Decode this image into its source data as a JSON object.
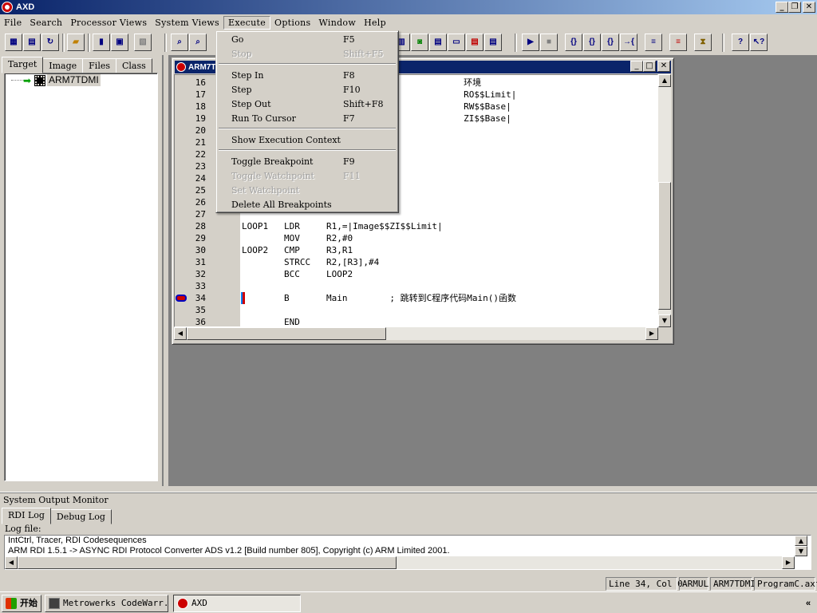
{
  "app": {
    "title": "AXD"
  },
  "menubar": [
    "File",
    "Search",
    "Processor Views",
    "System Views",
    "Execute",
    "Options",
    "Window",
    "Help"
  ],
  "execute_menu": {
    "items": [
      {
        "label": "Go",
        "key": "F5",
        "enabled": true
      },
      {
        "label": "Stop",
        "key": "Shift+F5",
        "enabled": false
      },
      {
        "label": "Step In",
        "key": "F8",
        "enabled": true
      },
      {
        "label": "Step",
        "key": "F10",
        "enabled": true
      },
      {
        "label": "Step Out",
        "key": "Shift+F8",
        "enabled": true
      },
      {
        "label": "Run To Cursor",
        "key": "F7",
        "enabled": true
      },
      {
        "label": "Show Execution Context",
        "key": "",
        "enabled": true
      },
      {
        "label": "Toggle Breakpoint",
        "key": "F9",
        "enabled": true
      },
      {
        "label": "Toggle Watchpoint",
        "key": "F11",
        "enabled": false
      },
      {
        "label": "Set Watchpoint",
        "key": "",
        "enabled": false
      },
      {
        "label": "Delete All Breakpoints",
        "key": "",
        "enabled": true
      }
    ]
  },
  "left_panel": {
    "tabs": [
      "Target",
      "Image",
      "Files",
      "Class"
    ],
    "tree": {
      "node_label": "ARM7TDMI"
    }
  },
  "code_window": {
    "title": "ARM7T",
    "lines": [
      {
        "n": "16",
        "text": "                                          环境"
      },
      {
        "n": "17",
        "text": "                                          RO$$Limit|"
      },
      {
        "n": "18",
        "text": "                                          RW$$Base|"
      },
      {
        "n": "19",
        "text": "                                          ZI$$Base|"
      },
      {
        "n": "20",
        "text": ""
      },
      {
        "n": "21",
        "text": ""
      },
      {
        "n": "22",
        "text": ""
      },
      {
        "n": "23",
        "text": ""
      },
      {
        "n": "24",
        "text": ""
      },
      {
        "n": "25",
        "text": ""
      },
      {
        "n": "26",
        "text": ""
      },
      {
        "n": "27",
        "text": ""
      },
      {
        "n": "28",
        "text": "LOOP1   LDR     R1,=|Image$$ZI$$Limit|"
      },
      {
        "n": "29",
        "text": "        MOV     R2,#0"
      },
      {
        "n": "30",
        "text": "LOOP2   CMP     R3,R1"
      },
      {
        "n": "31",
        "text": "        STRCC   R2,[R3],#4"
      },
      {
        "n": "32",
        "text": "        BCC     LOOP2"
      },
      {
        "n": "33",
        "text": ""
      },
      {
        "n": "34",
        "text": "        B       Main        ; 跳转到C程序代码Main()函数"
      },
      {
        "n": "35",
        "text": ""
      },
      {
        "n": "36",
        "text": "        END"
      }
    ],
    "current_line": "34"
  },
  "output_monitor": {
    "title": "System Output Monitor",
    "tabs": [
      "RDI Log",
      "Debug Log"
    ],
    "log_label": "Log file:",
    "log_lines": [
      "IntCtrl, Tracer, RDI Codesequences",
      "ARM RDI 1.5.1 -> ASYNC RDI Protocol Converter ADS v1.2 [Build number 805], Copyright (c) ARM Limited 2001."
    ]
  },
  "statusbar": [
    "Line 34, Col 0",
    "ARMUL",
    "ARM7TDMI",
    "ProgramC.axf"
  ],
  "taskbar": {
    "start_label": "开始",
    "items": [
      "Metrowerks CodeWarr...",
      "AXD"
    ]
  },
  "colors": {
    "title_active": "#0a246a",
    "face": "#d4d0c8",
    "desktop": "#808080",
    "breakpoint": "#cc0000"
  }
}
